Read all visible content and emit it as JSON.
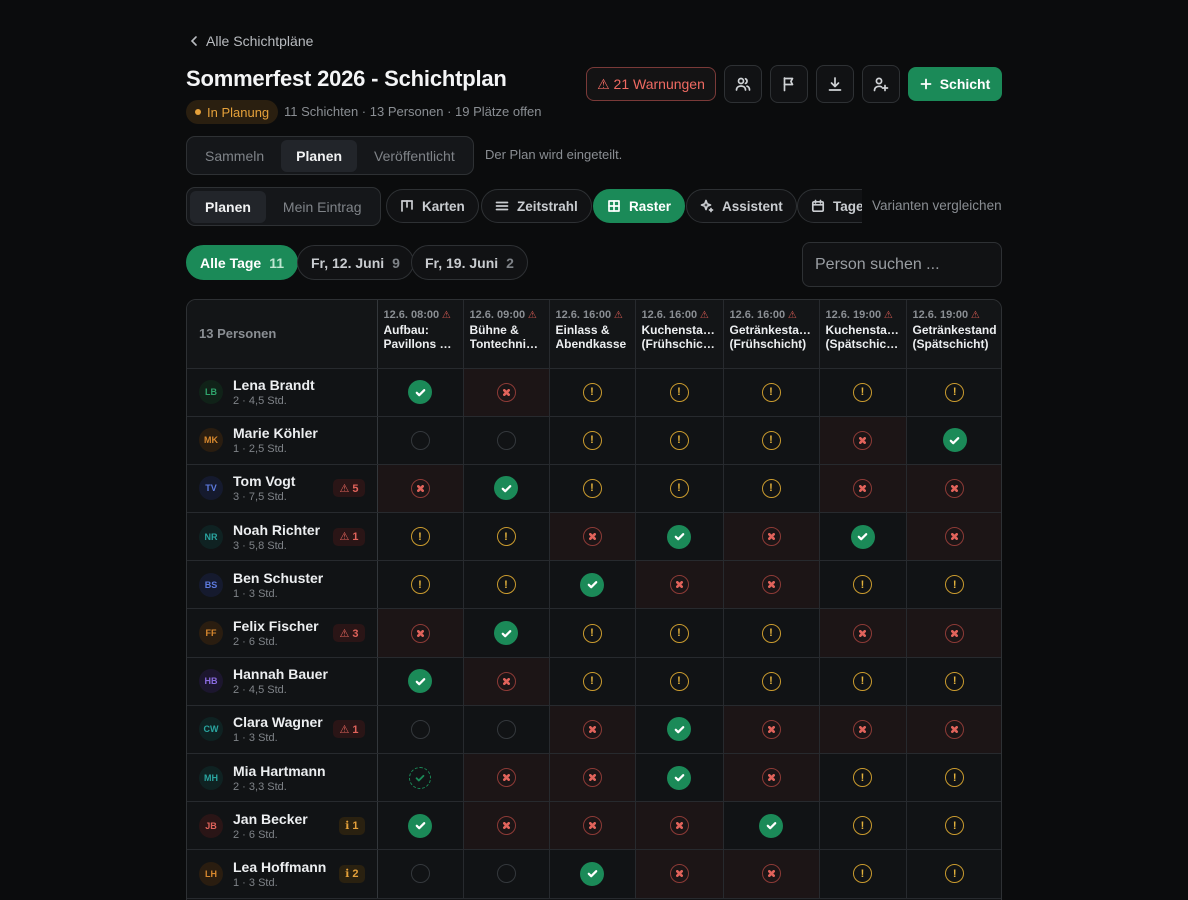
{
  "header": {
    "back_label": "Alle Schichtpläne",
    "title": "Sommerfest 2026 - Schichtplan",
    "status": "In Planung",
    "meta": "11 Schichten · 13 Personen · 19 Plätze offen",
    "warnings_label": "⚠ 21 Warnungen",
    "add_shift_label": "Schicht",
    "icons": [
      "people-icon",
      "flag-icon",
      "download-icon",
      "add-person-icon",
      "plus-icon"
    ]
  },
  "phase": {
    "options": [
      "Sammeln",
      "Planen",
      "Veröffentlicht"
    ],
    "active": "Planen",
    "description": "Der Plan wird eingeteilt."
  },
  "mode": {
    "options": [
      "Planen",
      "Mein Eintrag"
    ],
    "active": "Planen"
  },
  "views": {
    "options": [
      "Karten",
      "Zeitstrahl",
      "Raster",
      "Assistent",
      "Tages"
    ],
    "active": "Raster",
    "compare_label": "Varianten vergleichen"
  },
  "days": [
    {
      "label": "Alle Tage",
      "count": "11",
      "active": true
    },
    {
      "label": "Fr, 12. Juni",
      "count": "9",
      "active": false
    },
    {
      "label": "Fr, 19. Juni",
      "count": "2",
      "active": false
    }
  ],
  "search": {
    "placeholder": "Person suchen ..."
  },
  "grid": {
    "corner_label": "13 Personen",
    "shifts": [
      {
        "time": "12.6. 08:00",
        "name1": "Aufbau:",
        "name2": "Pavillons &..."
      },
      {
        "time": "12.6. 09:00",
        "name1": "Bühne &",
        "name2": "Tontechnik..."
      },
      {
        "time": "12.6. 16:00",
        "name1": "Einlass &",
        "name2": "Abendkasse"
      },
      {
        "time": "12.6. 16:00",
        "name1": "Kuchenstand",
        "name2": "(Frühschicht)"
      },
      {
        "time": "12.6. 16:00",
        "name1": "Getränkestand",
        "name2": "(Frühschicht)"
      },
      {
        "time": "12.6. 19:00",
        "name1": "Kuchenstand",
        "name2": "(Spätschicht)"
      },
      {
        "time": "12.6. 19:00",
        "name1": "Getränkestand",
        "name2": "(Spätschicht)"
      }
    ],
    "people": [
      {
        "initials": "LB",
        "name": "Lena Brandt",
        "sub": "2 · 4,5 Std.",
        "color": "#2fa36b",
        "bg": "#102218",
        "badge": "",
        "badge_type": "",
        "cells": [
          "ok",
          "x",
          "w",
          "w",
          "w",
          "w",
          "w"
        ]
      },
      {
        "initials": "MK",
        "name": "Marie Köhler",
        "sub": "1 · 2,5 Std.",
        "color": "#d9892e",
        "bg": "#2a1d10",
        "badge": "",
        "badge_type": "",
        "cells": [
          "e",
          "e",
          "w",
          "w",
          "w",
          "x",
          "ok"
        ]
      },
      {
        "initials": "TV",
        "name": "Tom Vogt",
        "sub": "3 · 7,5 Std.",
        "color": "#5e7be0",
        "bg": "#151a2e",
        "badge": "⚠ 5",
        "badge_type": "warn",
        "cells": [
          "x",
          "ok",
          "w",
          "w",
          "w",
          "x",
          "x"
        ]
      },
      {
        "initials": "NR",
        "name": "Noah Richter",
        "sub": "3 · 5,8 Std.",
        "color": "#2aa5a0",
        "bg": "#0f2222",
        "badge": "⚠ 1",
        "badge_type": "warn",
        "cells": [
          "w",
          "w",
          "x",
          "ok",
          "x",
          "ok",
          "x"
        ]
      },
      {
        "initials": "BS",
        "name": "Ben Schuster",
        "sub": "1 · 3 Std.",
        "color": "#5e7be0",
        "bg": "#151a2e",
        "badge": "",
        "badge_type": "",
        "cells": [
          "w",
          "w",
          "ok",
          "x",
          "x",
          "w",
          "w"
        ]
      },
      {
        "initials": "FF",
        "name": "Felix Fischer",
        "sub": "2 · 6 Std.",
        "color": "#d9892e",
        "bg": "#2a1d10",
        "badge": "⚠ 3",
        "badge_type": "warn",
        "cells": [
          "x",
          "ok",
          "w",
          "w",
          "w",
          "x",
          "x"
        ]
      },
      {
        "initials": "HB",
        "name": "Hannah Bauer",
        "sub": "2 · 4,5 Std.",
        "color": "#8a6be0",
        "bg": "#1c162e",
        "badge": "",
        "badge_type": "",
        "cells": [
          "ok",
          "x",
          "w",
          "w",
          "w",
          "w",
          "w"
        ]
      },
      {
        "initials": "CW",
        "name": "Clara Wagner",
        "sub": "1 · 3 Std.",
        "color": "#2aa5a0",
        "bg": "#0f2222",
        "badge": "⚠ 1",
        "badge_type": "warn",
        "cells": [
          "e",
          "e",
          "x",
          "ok",
          "x",
          "x",
          "x"
        ]
      },
      {
        "initials": "MH",
        "name": "Mia Hartmann",
        "sub": "2 · 3,3 Std.",
        "color": "#2aa5a0",
        "bg": "#0f2222",
        "badge": "",
        "badge_type": "",
        "cells": [
          "okd",
          "x",
          "x",
          "ok",
          "x",
          "w",
          "w"
        ]
      },
      {
        "initials": "JB",
        "name": "Jan Becker",
        "sub": "2 · 6 Std.",
        "color": "#e0635b",
        "bg": "#2a1516",
        "badge": "ℹ 1",
        "badge_type": "info",
        "cells": [
          "ok",
          "x",
          "x",
          "x",
          "ok",
          "w",
          "w"
        ]
      },
      {
        "initials": "LH",
        "name": "Lea Hoffmann",
        "sub": "1 · 3 Std.",
        "color": "#d9892e",
        "bg": "#2a1d10",
        "badge": "ℹ 2",
        "badge_type": "info",
        "cells": [
          "e",
          "e",
          "ok",
          "x",
          "x",
          "w",
          "w"
        ]
      }
    ]
  }
}
